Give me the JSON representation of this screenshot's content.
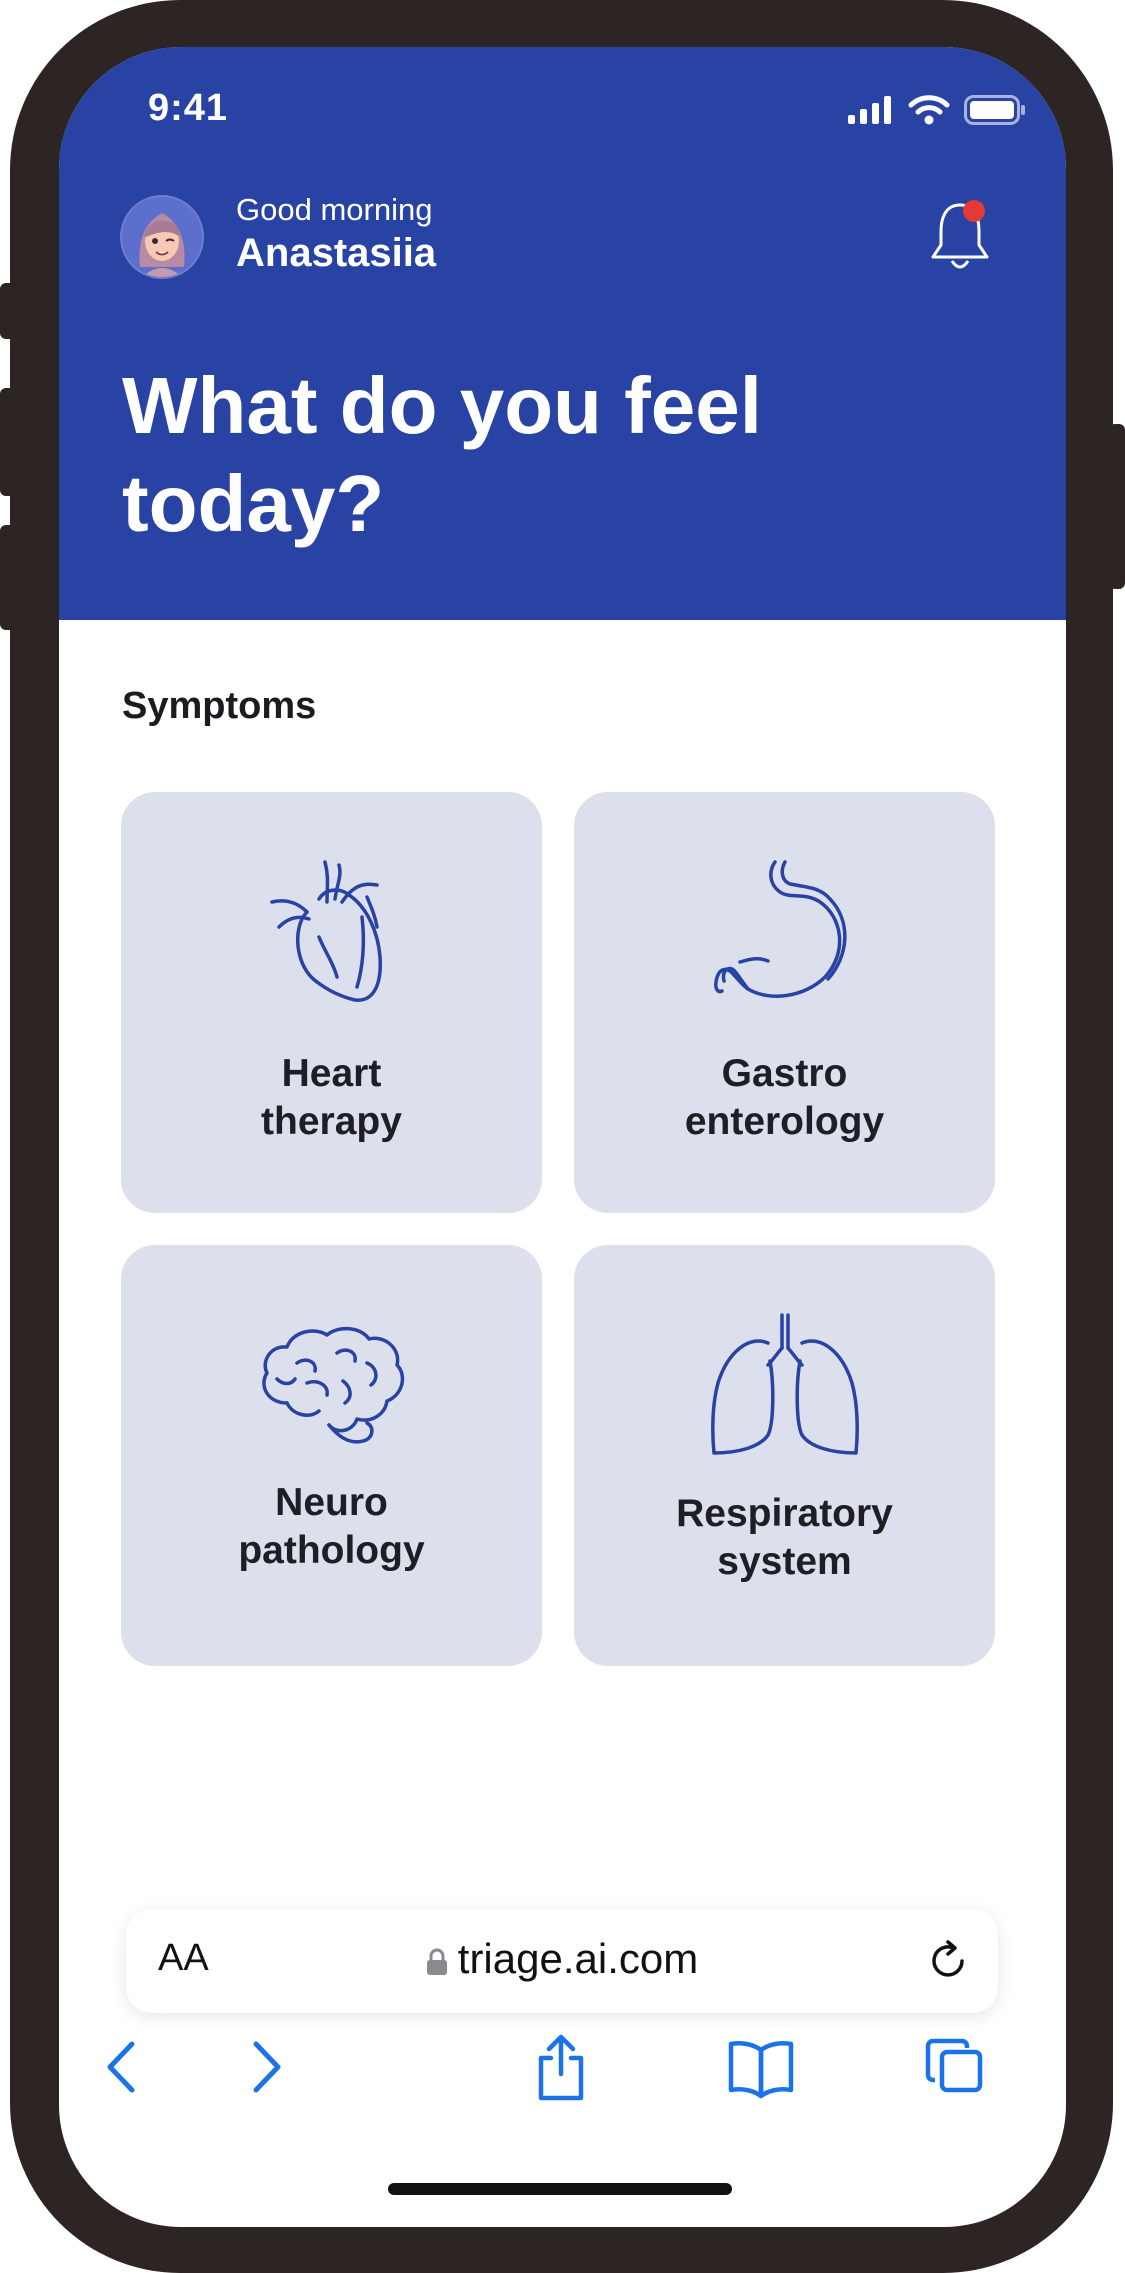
{
  "status_bar": {
    "time": "9:41"
  },
  "header": {
    "greeting": "Good morning",
    "user_name": "Anastasiia",
    "headline": "What do you feel today?",
    "notification_dot_color": "#e53935",
    "background_color": "#2843a3"
  },
  "symptoms": {
    "title": "Symptoms",
    "cards": [
      {
        "icon": "heart-icon",
        "line1": "Heart",
        "line2": "therapy"
      },
      {
        "icon": "stomach-icon",
        "line1": "Gastro",
        "line2": "enterology"
      },
      {
        "icon": "brain-icon",
        "line1": "Neuro",
        "line2": "pathology"
      },
      {
        "icon": "lungs-icon",
        "line1": "Respiratory",
        "line2": "system"
      }
    ]
  },
  "browser": {
    "text_size_label": "AA",
    "url": "triage.ai.com",
    "toolbar": [
      "back-icon",
      "forward-icon",
      "share-icon",
      "bookmarks-icon",
      "tabs-icon"
    ],
    "accent_color": "#1a73e8"
  }
}
